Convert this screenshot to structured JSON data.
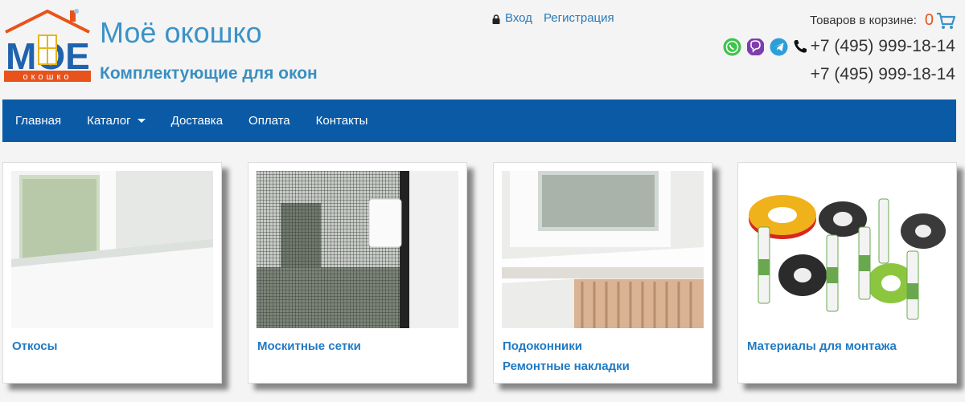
{
  "header": {
    "title": "Моё окошко",
    "subtitle": "Комплектующие для окон",
    "logo_text": "окошко",
    "logo_letters": "МОЕ"
  },
  "auth": {
    "login": "Вход",
    "register": "Регистрация"
  },
  "cart": {
    "label": "Товаров в корзине:",
    "count": "0"
  },
  "contacts": {
    "phone1": "+7 (495) 999-18-14",
    "phone2": "+7 (495) 999-18-14",
    "icons": [
      "whatsapp-icon",
      "viber-icon",
      "telegram-icon",
      "phone-icon"
    ]
  },
  "nav": {
    "items": [
      {
        "label": "Главная"
      },
      {
        "label": "Каталог",
        "dropdown": true
      },
      {
        "label": "Доставка"
      },
      {
        "label": "Оплата"
      },
      {
        "label": "Контакты"
      }
    ]
  },
  "cards": [
    {
      "links": [
        "Откосы"
      ]
    },
    {
      "links": [
        "Москитные сетки"
      ]
    },
    {
      "links": [
        "Подоконники",
        "Ремонтные накладки"
      ]
    },
    {
      "links": [
        "Материалы для монтажа"
      ]
    }
  ],
  "colors": {
    "accent": "#3a93c8",
    "nav_bg": "#0b5aa6",
    "link": "#1f7ac4",
    "cart_count": "#e8531c"
  }
}
